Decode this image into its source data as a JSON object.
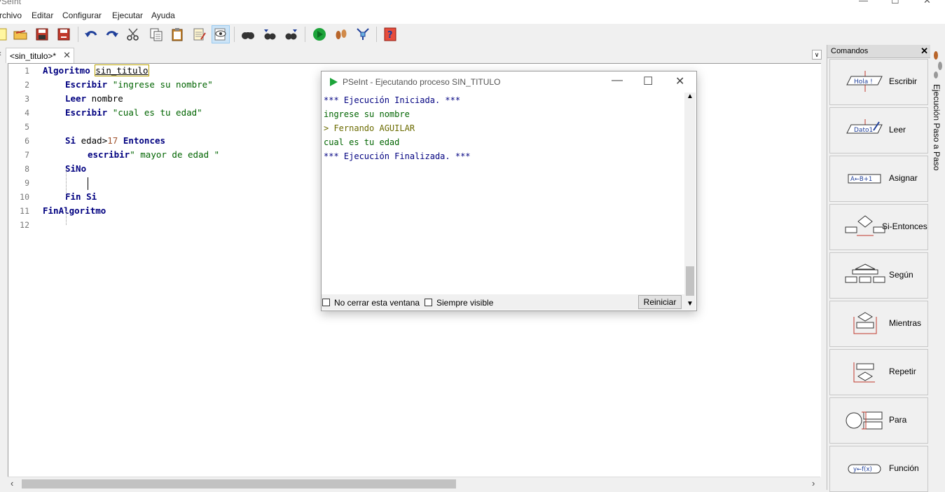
{
  "window": {
    "title": "PSeInt"
  },
  "menu": [
    "Archivo",
    "Editar",
    "Configurar",
    "Ejecutar",
    "Ayuda"
  ],
  "toolbar": {
    "icons": [
      "new-file-icon",
      "open-folder-icon",
      "save-icon",
      "save-as-icon",
      "undo-icon",
      "redo-icon",
      "cut-icon",
      "copy-icon",
      "paste-icon",
      "edit-icon",
      "inspect-icon",
      "find-icon",
      "find-previous-icon",
      "find-next-icon",
      "run-icon",
      "step-by-step-icon",
      "flowchart-icon",
      "help-icon"
    ]
  },
  "editor": {
    "tab_label": "<sin_titulo>*",
    "lines": [
      {
        "n": "1",
        "tokens": [
          {
            "c": "kw",
            "t": "Algoritmo"
          },
          {
            "c": "plain",
            "t": " "
          },
          {
            "c": "plain",
            "t": "sin_titulo"
          }
        ]
      },
      {
        "n": "2",
        "tokens": [
          {
            "c": "kw",
            "t": "Escribir"
          },
          {
            "c": "plain",
            "t": " "
          },
          {
            "c": "str",
            "t": "\"ingrese su nombre\""
          }
        ]
      },
      {
        "n": "3",
        "tokens": [
          {
            "c": "kw",
            "t": "Leer"
          },
          {
            "c": "plain",
            "t": " nombre"
          }
        ]
      },
      {
        "n": "4",
        "tokens": [
          {
            "c": "kw",
            "t": "Escribir"
          },
          {
            "c": "plain",
            "t": " "
          },
          {
            "c": "str",
            "t": "\"cual es tu edad\""
          }
        ]
      },
      {
        "n": "5",
        "tokens": []
      },
      {
        "n": "6",
        "tokens": [
          {
            "c": "kw",
            "t": "Si"
          },
          {
            "c": "plain",
            "t": " edad"
          },
          {
            "c": "plain",
            "t": ">"
          },
          {
            "c": "num",
            "t": "17"
          },
          {
            "c": "plain",
            "t": " "
          },
          {
            "c": "kw",
            "t": "Entonces"
          }
        ]
      },
      {
        "n": "7",
        "tokens": [
          {
            "c": "kw",
            "t": "escribir"
          },
          {
            "c": "str",
            "t": "\" mayor de edad \""
          }
        ]
      },
      {
        "n": "8",
        "tokens": [
          {
            "c": "kw",
            "t": "SiNo"
          }
        ]
      },
      {
        "n": "9",
        "tokens": []
      },
      {
        "n": "10",
        "tokens": [
          {
            "c": "kw",
            "t": "Fin Si"
          }
        ]
      },
      {
        "n": "11",
        "tokens": [
          {
            "c": "kw",
            "t": "FinAlgoritmo"
          }
        ]
      },
      {
        "n": "12",
        "tokens": []
      }
    ]
  },
  "commands": {
    "header": "Comandos",
    "items": [
      {
        "label": "Escribir",
        "icon": "write-icon",
        "icon_text": "Hola !"
      },
      {
        "label": "Leer",
        "icon": "read-icon",
        "icon_text": "Dato1"
      },
      {
        "label": "Asignar",
        "icon": "assign-icon",
        "icon_text": "A←B+1"
      },
      {
        "label": "Si-Entonces",
        "icon": "if-then-icon",
        "icon_text": ""
      },
      {
        "label": "Según",
        "icon": "switch-icon",
        "icon_text": ""
      },
      {
        "label": "Mientras",
        "icon": "while-icon",
        "icon_text": ""
      },
      {
        "label": "Repetir",
        "icon": "repeat-icon",
        "icon_text": ""
      },
      {
        "label": "Para",
        "icon": "for-icon",
        "icon_text": ""
      },
      {
        "label": "Función",
        "icon": "function-icon",
        "icon_text": "y←f(x)"
      }
    ]
  },
  "side_tab": {
    "label": "Ejecución Paso a Paso"
  },
  "run_window": {
    "title": "PSeInt - Ejecutando proceso SIN_TITULO",
    "console": [
      {
        "text": "*** Ejecución Iniciada. ***",
        "color": "#000080"
      },
      {
        "text": "ingrese su nombre",
        "color": "#006400"
      },
      {
        "text": "> Fernando AGUILAR",
        "color": "#6b6b00"
      },
      {
        "text": "cual es tu edad",
        "color": "#006400"
      },
      {
        "text": "*** Ejecución Finalizada. ***",
        "color": "#000080"
      }
    ],
    "no_close_label": "No cerrar esta ventana",
    "always_visible_label": "Siempre visible",
    "restart_label": "Reiniciar"
  }
}
